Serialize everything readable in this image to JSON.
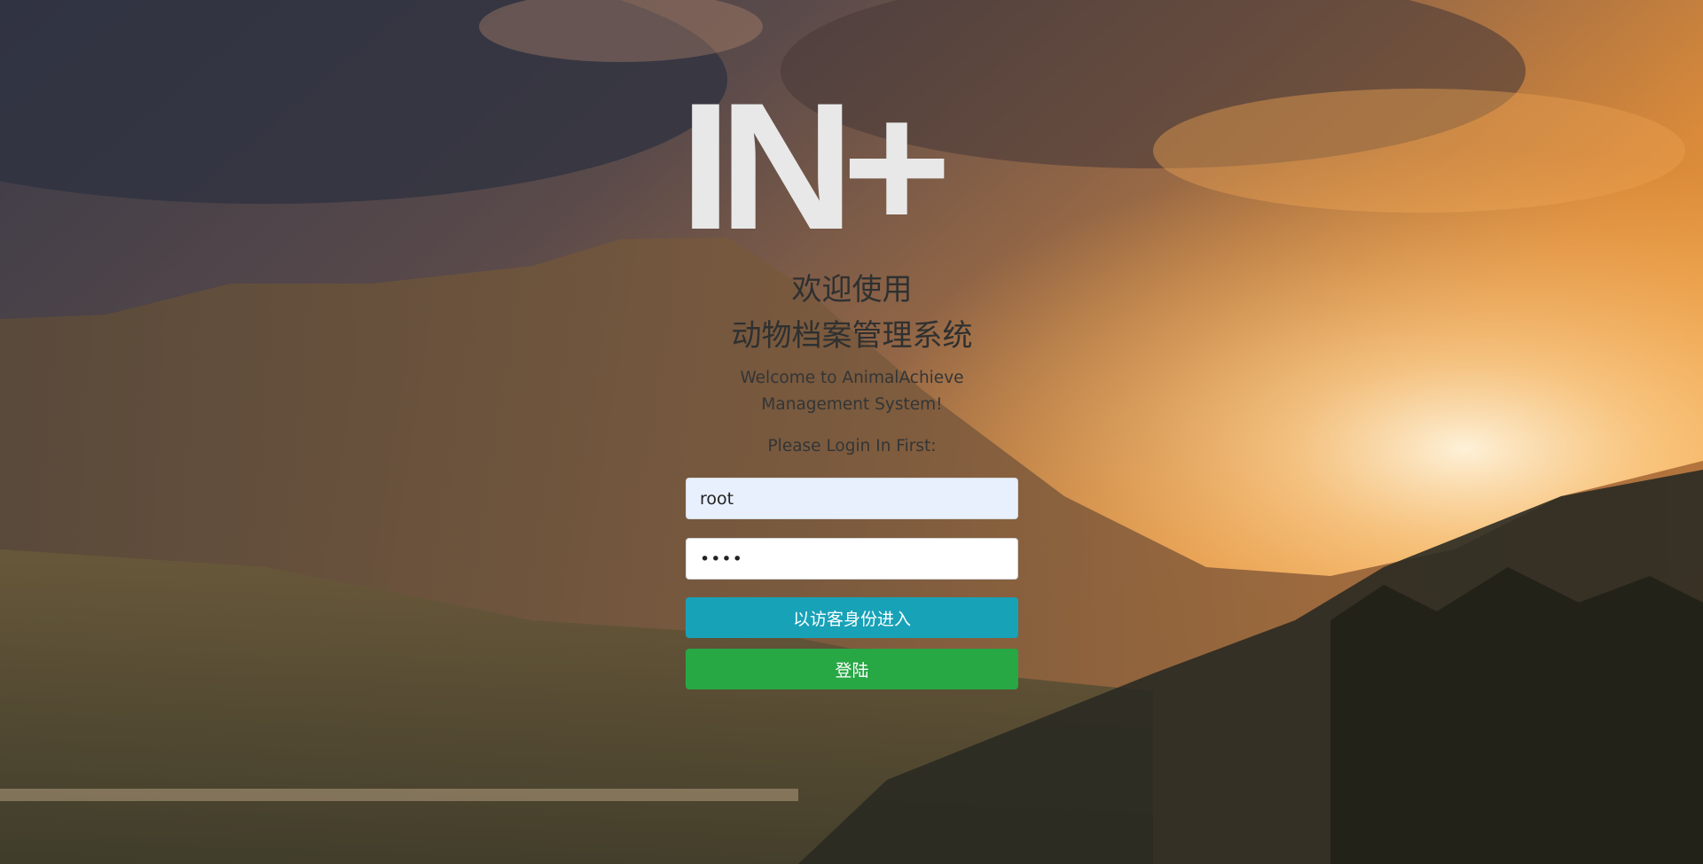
{
  "branding": {
    "logo_text": "IN+"
  },
  "header": {
    "title_line1": "欢迎使用",
    "title_line2": "动物档案管理系统",
    "subtitle": "Welcome to AnimalAchieve Management System!",
    "prompt": "Please Login In First:"
  },
  "form": {
    "username_value": "root",
    "password_value": "1234"
  },
  "actions": {
    "guest_label": "以访客身份进入",
    "login_label": "登陆"
  },
  "colors": {
    "guest_button": "#17a2b8",
    "login_button": "#28a745",
    "username_autofill_bg": "#e8f0fe"
  }
}
